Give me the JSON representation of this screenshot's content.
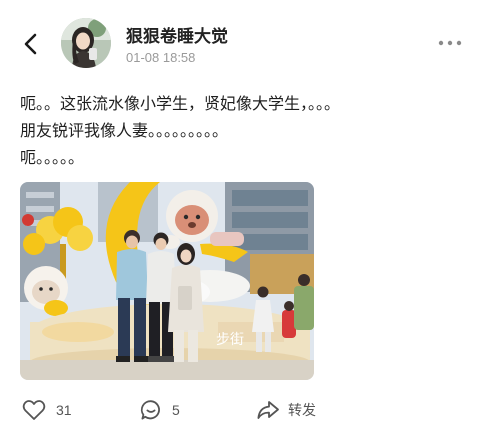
{
  "header": {
    "back_icon": "chevron-left-icon",
    "author_name": "狠狠卷睡大觉",
    "post_time": "01-08 18:58",
    "more_icon": "more-dots-icon"
  },
  "post": {
    "lines": [
      "呃。。这张流水像小学生，贤妃像大学生，。。。",
      "朋友锐评我像人妻。。。。。。。。。",
      "呃。。。。。"
    ],
    "photo": {
      "sign_text": "步街",
      "colors": {
        "sky": "#dfe6ee",
        "balloon_yellow": "#f5c518",
        "stage_cream": "#efe2c2",
        "building_gray": "#8f9aa6"
      }
    }
  },
  "actions": {
    "like": {
      "icon": "heart-icon",
      "count": "31"
    },
    "comment": {
      "icon": "comment-icon",
      "count": "5"
    },
    "share": {
      "icon": "share-icon",
      "label": "转发"
    }
  }
}
